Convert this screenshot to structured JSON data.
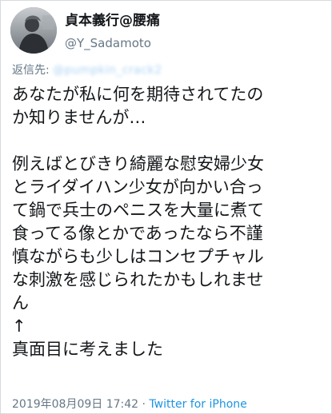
{
  "user": {
    "display_name": "貞本義行@腰痛",
    "handle": "@Y_Sadamoto",
    "avatar_icon": "profile-photo-icon"
  },
  "reply": {
    "prefix": "返信先:",
    "target": "@pumpkin_crack2"
  },
  "tweet": {
    "lines": [
      "あなたが私に何を期待されてたの",
      "か知りませんが…",
      "",
      "例えばとびきり綺麗な慰安婦少女",
      "とライダイハン少女が向かい合っ",
      "て鍋で兵士のペニスを大量に煮て",
      "食ってる像とかであったなら不謹",
      "慎ながらも少しはコンセプチャル",
      "な刺激を感じられたかもしれませ",
      "ん",
      "↑",
      "真面目に考えました"
    ]
  },
  "meta": {
    "timestamp": "2019年08月09日 17:42",
    "separator": " · ",
    "source": "Twitter for iPhone"
  },
  "colors": {
    "text": "#14171a",
    "secondary": "#657786",
    "link": "#1b95e0",
    "border": "#d6dbdf"
  }
}
